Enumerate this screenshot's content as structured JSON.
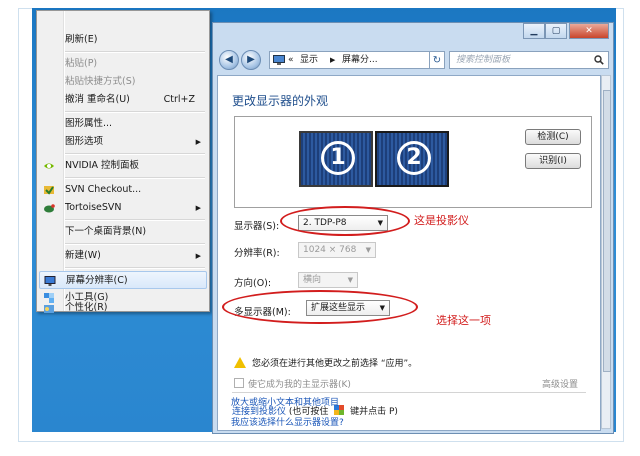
{
  "context_menu": {
    "items": [
      {
        "label": "刷新(E)",
        "state": "normal"
      },
      {
        "label": "粘贴(P)",
        "state": "disabled"
      },
      {
        "label": "粘贴快捷方式(S)",
        "state": "disabled"
      },
      {
        "label": "撤消 重命名(U)",
        "shortcut": "Ctrl+Z",
        "state": "normal"
      },
      {
        "label": "图形属性...",
        "state": "normal"
      },
      {
        "label": "图形选项",
        "state": "normal",
        "submenu": true
      },
      {
        "label": "NVIDIA 控制面板",
        "state": "normal",
        "icon": "nvidia-icon"
      },
      {
        "label": "SVN Checkout...",
        "state": "normal",
        "icon": "svn-checkout-icon"
      },
      {
        "label": "TortoiseSVN",
        "state": "normal",
        "icon": "tortoisesvn-icon",
        "submenu": true
      },
      {
        "label": "下一个桌面背景(N)",
        "state": "normal"
      },
      {
        "label": "新建(W)",
        "state": "normal",
        "submenu": true
      },
      {
        "label": "屏幕分辨率(C)",
        "state": "highlighted",
        "icon": "display-icon"
      },
      {
        "label": "小工具(G)",
        "state": "normal",
        "icon": "gadgets-icon"
      },
      {
        "label": "个性化(R)",
        "state": "normal",
        "icon": "personalize-icon"
      }
    ]
  },
  "window": {
    "breadcrumb": [
      "«",
      "显示",
      "屏幕分..."
    ],
    "search_placeholder": "搜索控制面板",
    "heading": "更改显示器的外观",
    "monitors": [
      "1",
      "2"
    ],
    "detect_button": "检测(C)",
    "identify_button": "识别(I)",
    "display_label": "显示器(S):",
    "display_value": "2. TDP-P8",
    "resolution_label": "分辨率(R):",
    "resolution_value": "1024 × 768",
    "orientation_label": "方向(O):",
    "orientation_value": "横向",
    "multi_display_label": "多显示器(M):",
    "multi_display_value": "扩展这些显示",
    "warning": "您必须在进行其他更改之前选择 “应用”。",
    "make_main_checkbox": "使它成为我的主显示器(K)",
    "advanced_link": "高级设置",
    "links": {
      "projector_prefix": "连接到投影仪",
      "projector_suffix_a": " (也可按住 ",
      "projector_suffix_b": " 键并点击 P)",
      "enlarge_text": "放大或缩小文本和其他项目",
      "which_setting": "我应该选择什么显示器设置?"
    }
  },
  "annotations": {
    "projector_note": "这是投影仪",
    "select_note": "选择这一项",
    "color": "#d21d1d"
  }
}
